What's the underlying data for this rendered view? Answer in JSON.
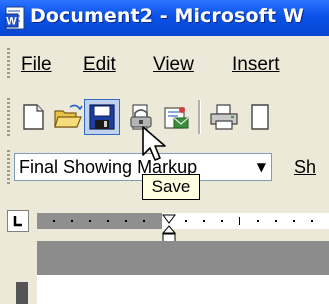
{
  "window": {
    "title": "Document2 - Microsoft W",
    "app_icon": "word-icon"
  },
  "menu": [
    {
      "label": "File"
    },
    {
      "label": "Edit"
    },
    {
      "label": "View"
    },
    {
      "label": "Insert"
    }
  ],
  "toolbar": {
    "buttons": [
      {
        "name": "new-blank-document-icon"
      },
      {
        "name": "open-folder-icon"
      },
      {
        "name": "save-icon",
        "pressed": true
      },
      {
        "name": "permission-icon"
      },
      {
        "name": "email-icon"
      },
      {
        "name": "print-icon"
      }
    ]
  },
  "reviewing": {
    "markup_select_value": "Final Showing Markup",
    "show_label": "Sh"
  },
  "tooltip": {
    "text": "Save"
  },
  "ruler": {
    "tab_type_symbol": "L"
  }
}
